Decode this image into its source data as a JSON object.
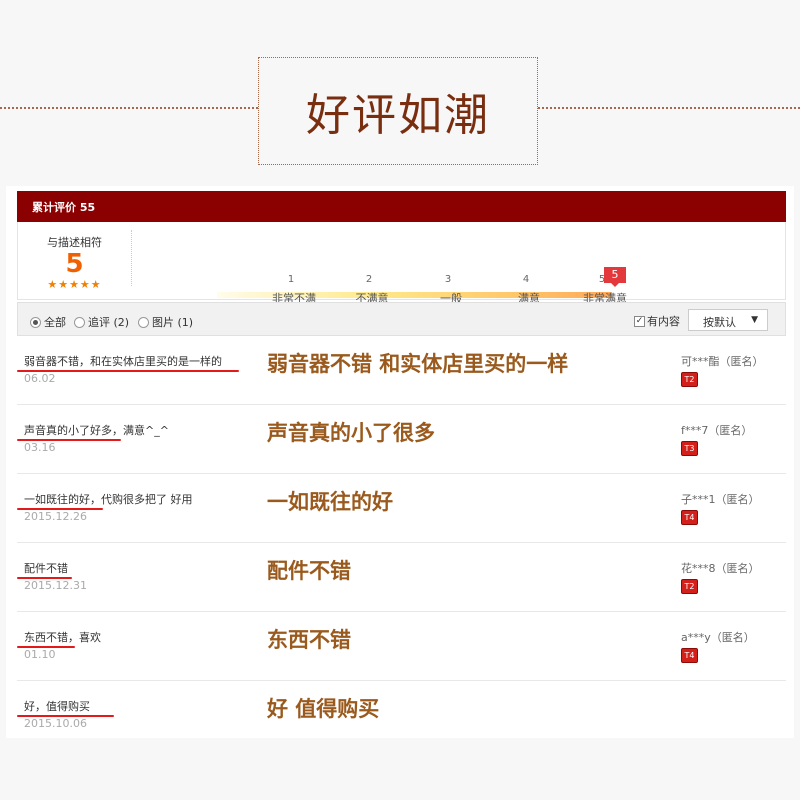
{
  "banner": {
    "title": "好评如潮"
  },
  "summary": {
    "header": "累计评价 55",
    "desc_label": "与描述相符",
    "score": "5",
    "stars": "★★★★★",
    "marker": "5",
    "scale": {
      "numbers": [
        "1",
        "2",
        "3",
        "4",
        "5"
      ],
      "labels": [
        "非常不满",
        "不满意",
        "一般",
        "满意",
        "非常满意"
      ]
    }
  },
  "filters": {
    "all": "全部",
    "followup": "追评 (2)",
    "pictures": "图片 (1)",
    "has_content": "有内容",
    "sort": "按默认"
  },
  "reviews": [
    {
      "text": "弱音器不错，和在实体店里买的是一样的",
      "date": "06.02",
      "highlight": "弱音器不错  和实体店里买的一样",
      "user": "可***酯",
      "anon": "（匿名）",
      "badge": "T2"
    },
    {
      "text": "声音真的小了好多，满意^_^",
      "date": "03.16",
      "highlight": "声音真的小了很多",
      "user": "f***7",
      "anon": "（匿名）",
      "badge": "T3"
    },
    {
      "text": "一如既往的好，代购很多把了 好用",
      "date": "2015.12.26",
      "highlight": "一如既往的好",
      "user": "子***1",
      "anon": "（匿名）",
      "badge": "T4"
    },
    {
      "text": "配件不错",
      "date": "2015.12.31",
      "highlight": "配件不错",
      "user": "花***8",
      "anon": "（匿名）",
      "badge": "T2"
    },
    {
      "text": "东西不错，喜欢",
      "date": "01.10",
      "highlight": "东西不错",
      "user": "a***y",
      "anon": "（匿名）",
      "badge": "T4"
    },
    {
      "text": "好，值得购买",
      "date": "2015.10.06",
      "highlight": "好  值得购买",
      "user": "",
      "anon": "",
      "badge": ""
    }
  ],
  "colors": {
    "bar": "#8b0000",
    "accent": "#f06000",
    "highlight": "#9a5a1d",
    "underline": "#e21a1a"
  }
}
